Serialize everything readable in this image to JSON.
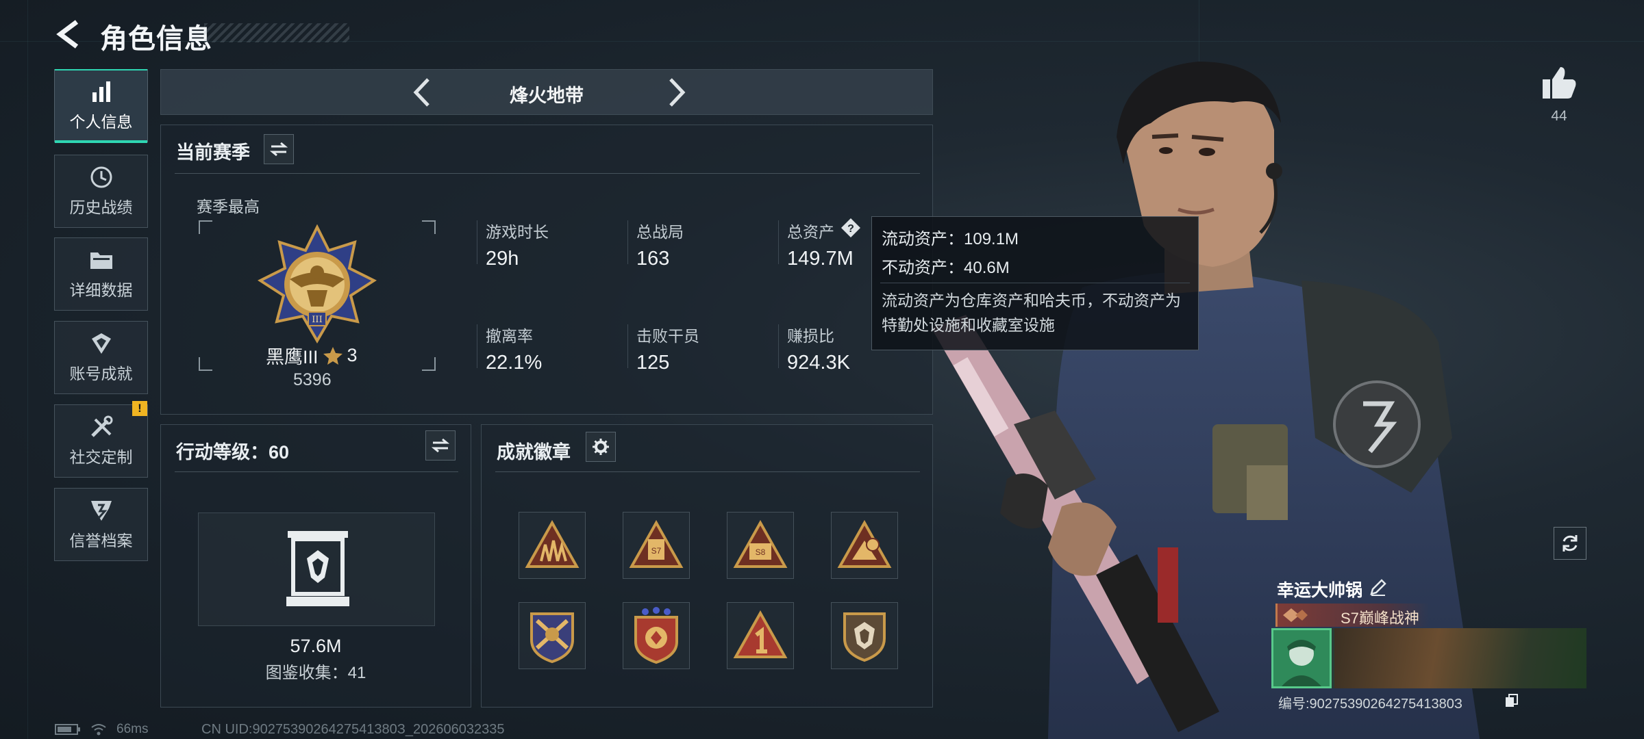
{
  "header": {
    "title": "角色信息"
  },
  "sidebar": {
    "items": [
      {
        "label": "个人信息",
        "icon": "bar-chart-icon",
        "active": true
      },
      {
        "label": "历史战绩",
        "icon": "history-clock-icon",
        "active": false
      },
      {
        "label": "详细数据",
        "icon": "folder-icon",
        "active": false
      },
      {
        "label": "账号成就",
        "icon": "achievement-icon",
        "active": false
      },
      {
        "label": "社交定制",
        "icon": "tools-icon",
        "active": false,
        "notice": "!"
      },
      {
        "label": "信誉档案",
        "icon": "credit-shield-icon",
        "active": false
      }
    ]
  },
  "mode_selector": {
    "name": "烽火地带"
  },
  "season_panel": {
    "title": "当前赛季",
    "best_label": "赛季最高",
    "rank": {
      "name": "黑鹰III",
      "stars": "3",
      "score": "5396"
    },
    "stats": [
      {
        "label": "游戏时长",
        "value": "29h"
      },
      {
        "label": "总战局",
        "value": "163"
      },
      {
        "label": "总资产",
        "value": "149.7M",
        "help": "?"
      },
      {
        "label": "撤离率",
        "value": "22.1%"
      },
      {
        "label": "击败干员",
        "value": "125"
      },
      {
        "label": "赚损比",
        "value": "924.3K"
      }
    ]
  },
  "tooltip": {
    "liquid": "流动资产：109.1M",
    "fixed": "不动资产：40.6M",
    "description": "流动资产为仓库资产和哈夫币，不动资产为特勤处设施和收藏室设施"
  },
  "level_panel": {
    "title": "行动等级：60",
    "collection_value": "57.6M",
    "collection_label": "图鉴收集：41"
  },
  "achievement_panel": {
    "title": "成就徽章",
    "badges": [
      "badge-soldiers",
      "badge-s7",
      "badge-s8",
      "badge-s4",
      "badge-crossed",
      "badge-stars-shield",
      "badge-number-one",
      "badge-helmet"
    ]
  },
  "character": {
    "likes": "44",
    "player_name": "幸运大帅锅",
    "player_title": "S7巅峰战神",
    "player_id": "编号:9027539026427541380З"
  },
  "status": {
    "ping": "66ms",
    "uid": "CN UID:9027539026427541380З_202606032335"
  },
  "colors": {
    "accent": "#2fd6b2",
    "notice": "#f0b422",
    "gold": "#c99a4a"
  }
}
